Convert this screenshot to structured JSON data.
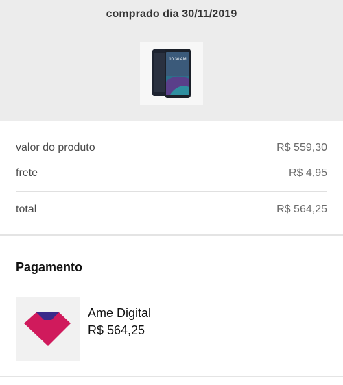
{
  "header": {
    "purchase_date_label": "comprado dia 30/11/2019",
    "product_image": "smartphone-image",
    "phone_screen_time": "10:30 AM"
  },
  "summary": {
    "product_label": "valor do produto",
    "product_value": "R$ 559,30",
    "shipping_label": "frete",
    "shipping_value": "R$ 4,95",
    "total_label": "total",
    "total_value": "R$ 564,25"
  },
  "payment": {
    "title": "Pagamento",
    "method_name": "Ame Digital",
    "method_amount": "R$ 564,25",
    "logo_icon": "ame-digital-logo-icon",
    "logo_colors": [
      "#d01a5c",
      "#3a2a8a"
    ]
  }
}
